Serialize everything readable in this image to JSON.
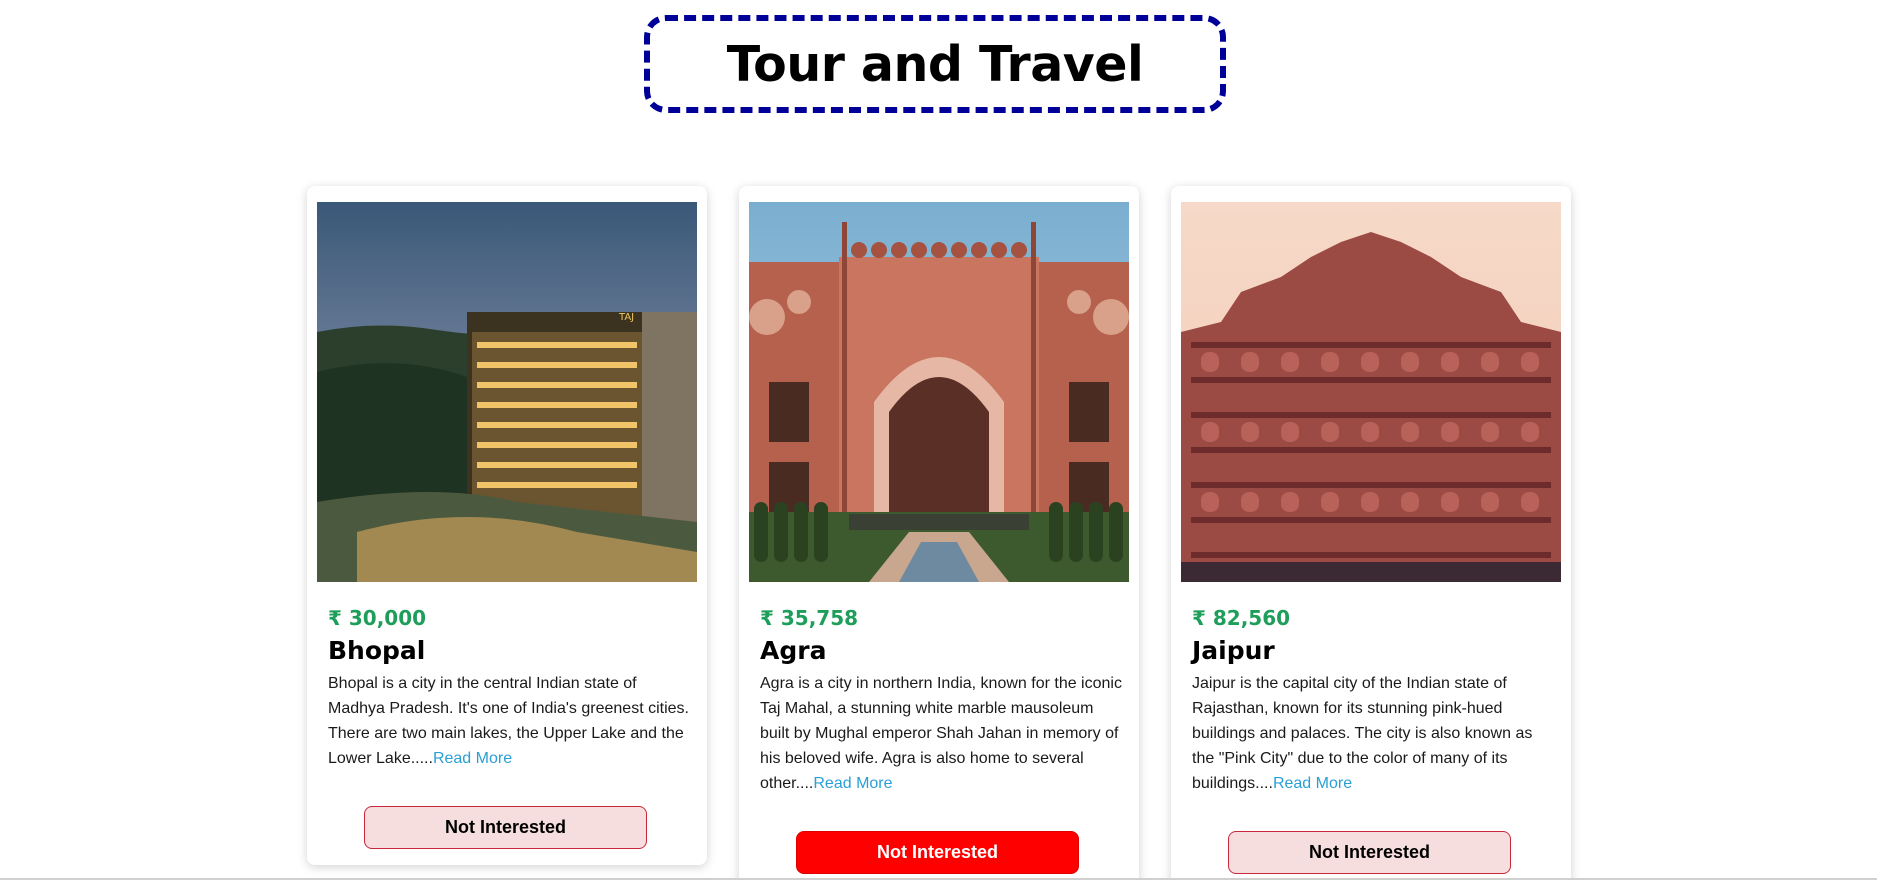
{
  "header": {
    "title": "Tour and Travel"
  },
  "cards": [
    {
      "price": "₹ 30,000",
      "city": "Bhopal",
      "description": "Bhopal is a city in the central Indian state of Madhya Pradesh. It's one of India's greenest cities. There are two main lakes, the Upper Lake and the Lower Lake.....",
      "read_more": "Read More",
      "button_label": "Not Interested",
      "button_state": "default",
      "image": "hotel-photo"
    },
    {
      "price": "₹ 35,758",
      "city": "Agra",
      "description": "Agra is a city in northern India, known for the iconic Taj Mahal, a stunning white marble mausoleum built by Mughal emperor Shah Jahan in memory of his beloved wife. Agra is also home to several other....",
      "read_more": "Read More",
      "button_label": "Not Interested",
      "button_state": "active",
      "image": "taj-gate-photo"
    },
    {
      "price": "₹ 82,560",
      "city": "Jaipur",
      "description": "Jaipur is the capital city of the Indian state of Rajasthan, known for its stunning pink-hued buildings and palaces. The city is also known as the \"Pink City\" due to the color of many of its buildings....",
      "read_more": "Read More",
      "button_label": "Not Interested",
      "button_state": "default",
      "image": "hawa-mahal-photo"
    }
  ],
  "colors": {
    "title_border": "#000099",
    "price": "#1e9e5a",
    "link": "#2a9fd6",
    "button_active": "#ff0000",
    "button_default_bg": "#f6dede",
    "button_border": "#c8283a"
  }
}
